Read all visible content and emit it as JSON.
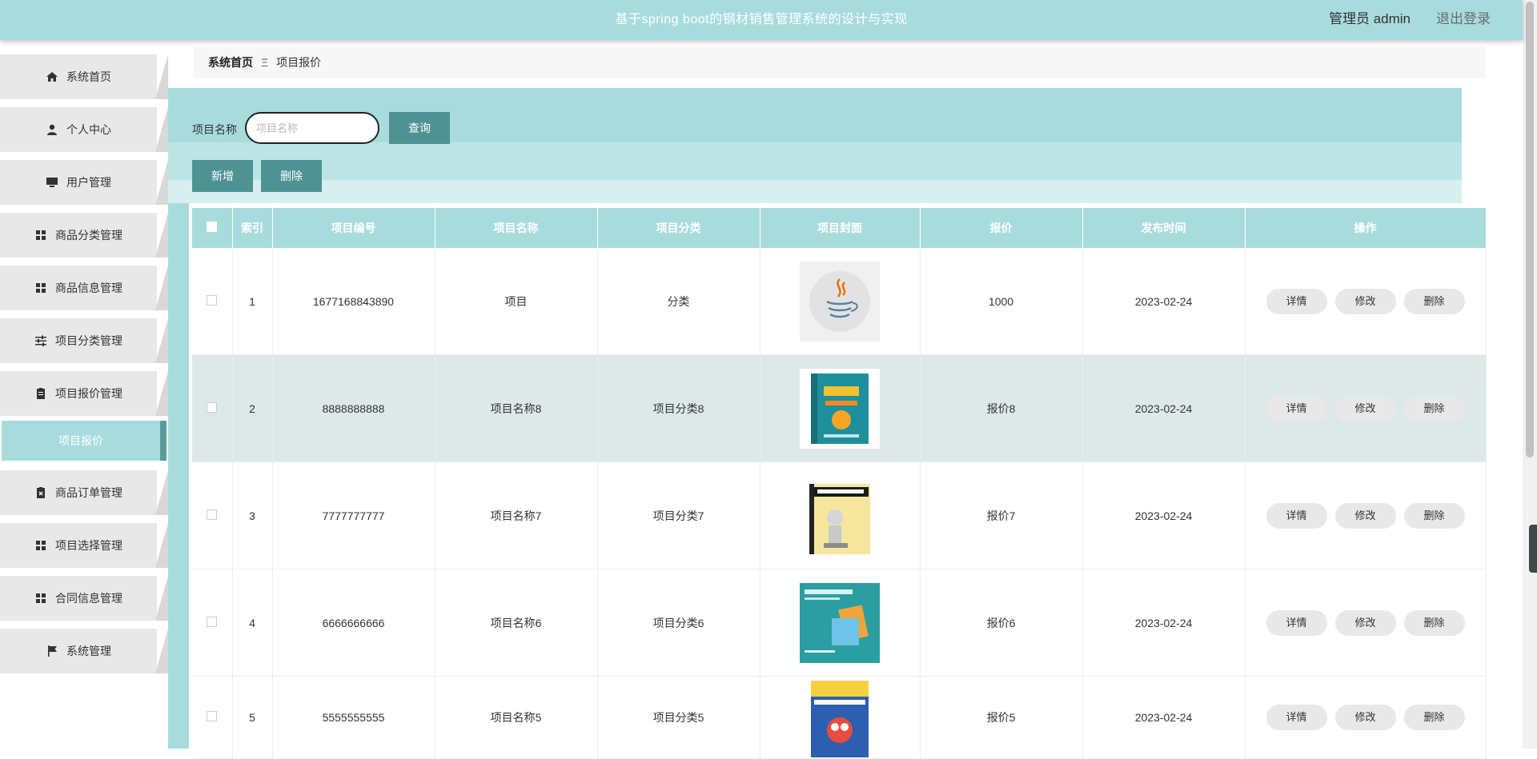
{
  "header": {
    "title": "基于spring boot的钢材销售管理系统的设计与实现",
    "user": "管理员 admin",
    "logout": "退出登录"
  },
  "sidebar": {
    "items": [
      {
        "label": "系统首页",
        "icon": "home-icon"
      },
      {
        "label": "个人中心",
        "icon": "user-icon"
      },
      {
        "label": "用户管理",
        "icon": "monitor-icon"
      },
      {
        "label": "商品分类管理",
        "icon": "grid-icon"
      },
      {
        "label": "商品信息管理",
        "icon": "grid-icon"
      },
      {
        "label": "项目分类管理",
        "icon": "sliders-icon"
      },
      {
        "label": "项目报价管理",
        "icon": "clipboard-icon"
      },
      {
        "label": "商品订单管理",
        "icon": "clipboard-x-icon"
      },
      {
        "label": "项目选择管理",
        "icon": "grid-icon"
      },
      {
        "label": "合同信息管理",
        "icon": "grid-icon"
      },
      {
        "label": "系统管理",
        "icon": "flag-icon"
      }
    ],
    "sub_item": "项目报价"
  },
  "breadcrumb": {
    "home": "系统首页",
    "separator": "Ξ",
    "current": "项目报价"
  },
  "search": {
    "label": "项目名称",
    "placeholder": "项目名称",
    "query_label": "查询"
  },
  "actions": {
    "add_label": "新增",
    "delete_label": "删除"
  },
  "table": {
    "headers": [
      "索引",
      "项目编号",
      "项目名称",
      "项目分类",
      "项目封面",
      "报价",
      "发布时间",
      "操作"
    ],
    "op_labels": {
      "detail": "详情",
      "edit": "修改",
      "delete": "删除"
    },
    "rows": [
      {
        "index": "1",
        "code": "1677168843890",
        "name": "项目",
        "category": "分类",
        "cover": "java-logo",
        "price": "1000",
        "date": "2023-02-24"
      },
      {
        "index": "2",
        "code": "8888888888",
        "name": "项目名称8",
        "category": "项目分类8",
        "cover": "scratch-book",
        "price": "报价8",
        "date": "2023-02-24"
      },
      {
        "index": "3",
        "code": "7777777777",
        "name": "项目名称7",
        "category": "项目分类7",
        "cover": "python-book",
        "price": "报价7",
        "date": "2023-02-24"
      },
      {
        "index": "4",
        "code": "6666666666",
        "name": "项目名称6",
        "category": "项目分类6",
        "cover": "scratch-teal-book",
        "price": "报价6",
        "date": "2023-02-24"
      },
      {
        "index": "5",
        "code": "5555555555",
        "name": "项目名称5",
        "category": "项目分类5",
        "cover": "scratch-blue-book",
        "price": "报价5",
        "date": "2023-02-24"
      }
    ]
  },
  "colors": {
    "accent": "#a8dcdc",
    "button": "#4f9292",
    "sidebar_item": "#e8e8e8"
  }
}
